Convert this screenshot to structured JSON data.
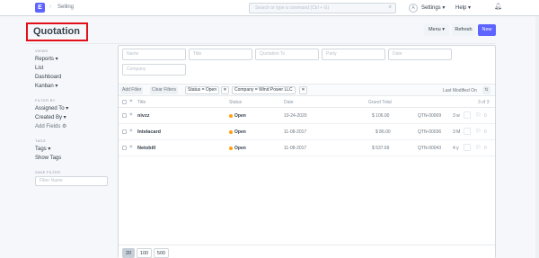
{
  "navbar": {
    "logo_letter": "E",
    "breadcrumb": "Selling",
    "search_placeholder": "Search or type a command (Ctrl + G)",
    "settings_label": "Settings",
    "help_label": "Help",
    "avatar_letter": "A"
  },
  "header": {
    "title": "Quotation",
    "menu_label": "Menu",
    "refresh_label": "Refresh",
    "new_label": "New"
  },
  "sidebar": {
    "views_heading": "VIEWS",
    "views": [
      "Reports",
      "List",
      "Dashboard",
      "Kanban"
    ],
    "filter_heading": "FILTER BY",
    "filters": [
      "Assigned To",
      "Created By",
      "Add Fields"
    ],
    "tags_heading": "TAGS",
    "tags": [
      "Tags",
      "Show Tags"
    ],
    "save_heading": "SAVE FILTER",
    "save_placeholder": "Filter Name"
  },
  "filters": {
    "inputs": [
      "Name",
      "Title",
      "Quotation To",
      "Party",
      "Date",
      "Company"
    ],
    "add_filter": "Add Filter",
    "clear_filters": "Clear Filters",
    "chips": [
      "Status = Open",
      "Company = Wind Power LLC"
    ],
    "sort_label": "Last Modified On",
    "sort_icon": "⇅"
  },
  "list": {
    "columns": {
      "title": "Title",
      "status": "Status",
      "date": "Date",
      "grand_total": "Grand Total"
    },
    "count": "3 of 3",
    "rows": [
      {
        "name": "nivzz",
        "status": "Open",
        "date": "10-24-2020",
        "total": "$ 106.00",
        "id": "QTN-00009",
        "modified": "3 w",
        "comments": "0"
      },
      {
        "name": "Intelacard",
        "status": "Open",
        "date": "11-08-2017",
        "total": "$ 86.00",
        "id": "QTN-00036",
        "modified": "3 M",
        "comments": "0"
      },
      {
        "name": "Netobill",
        "status": "Open",
        "date": "11-08-2017",
        "total": "$ 537.69",
        "id": "QTN-00043",
        "modified": "4 y",
        "comments": "0"
      }
    ]
  },
  "paging": [
    "20",
    "100",
    "500"
  ],
  "colors": {
    "primary": "#5e64ff",
    "highlight": "#e2101a",
    "open_status": "#ffa00a"
  }
}
